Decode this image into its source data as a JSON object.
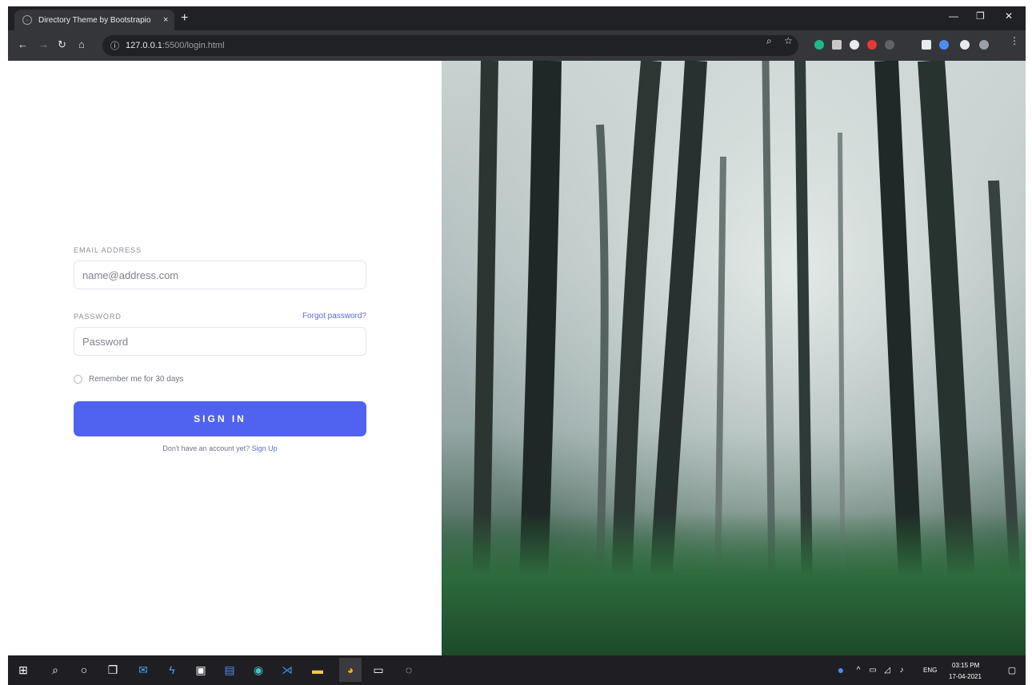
{
  "browser": {
    "tab_title": "Directory Theme by Bootstrapio",
    "tab_close": "×",
    "new_tab": "+",
    "url_host": "127.0.0.1",
    "url_rest": ":5500/login.html"
  },
  "login": {
    "email_label": "EMAIL ADDRESS",
    "email_placeholder": "name@address.com",
    "password_label": "PASSWORD",
    "forgot_password": "Forgot password?",
    "password_placeholder": "Password",
    "remember_me": "Remember me for 30 days",
    "sign_in_button": "SIGN IN",
    "no_account_text": "Don't have an account yet?",
    "sign_up_link": "Sign Up"
  },
  "taskbar": {
    "time": "03:15 PM",
    "date": "17-04-2021",
    "language": "ENG"
  },
  "colors": {
    "accent": "#4f63f0",
    "link": "#5a6bd6"
  }
}
